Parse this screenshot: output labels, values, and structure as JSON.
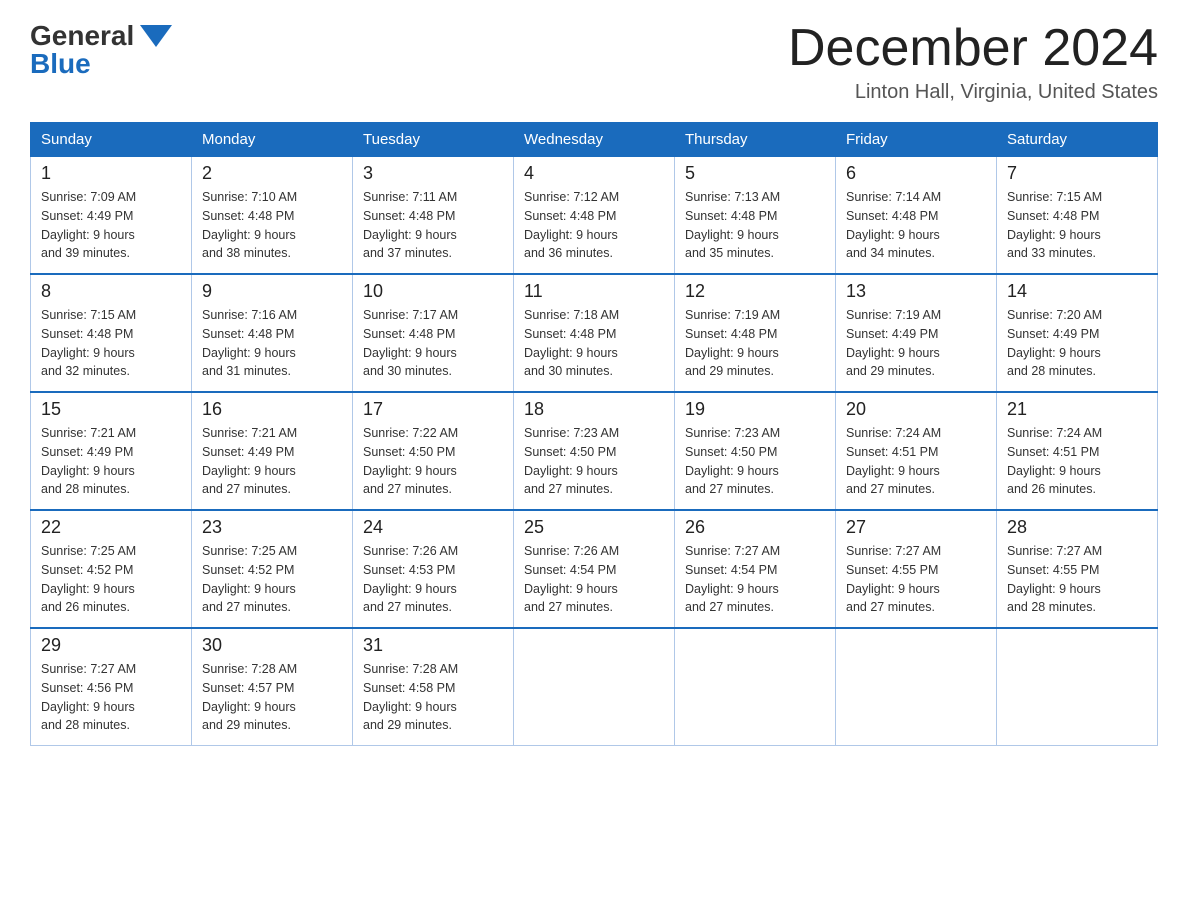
{
  "logo": {
    "general": "General",
    "blue": "Blue"
  },
  "title": "December 2024",
  "location": "Linton Hall, Virginia, United States",
  "weekdays": [
    "Sunday",
    "Monday",
    "Tuesday",
    "Wednesday",
    "Thursday",
    "Friday",
    "Saturday"
  ],
  "weeks": [
    [
      {
        "day": "1",
        "sunrise": "7:09 AM",
        "sunset": "4:49 PM",
        "daylight": "9 hours and 39 minutes."
      },
      {
        "day": "2",
        "sunrise": "7:10 AM",
        "sunset": "4:48 PM",
        "daylight": "9 hours and 38 minutes."
      },
      {
        "day": "3",
        "sunrise": "7:11 AM",
        "sunset": "4:48 PM",
        "daylight": "9 hours and 37 minutes."
      },
      {
        "day": "4",
        "sunrise": "7:12 AM",
        "sunset": "4:48 PM",
        "daylight": "9 hours and 36 minutes."
      },
      {
        "day": "5",
        "sunrise": "7:13 AM",
        "sunset": "4:48 PM",
        "daylight": "9 hours and 35 minutes."
      },
      {
        "day": "6",
        "sunrise": "7:14 AM",
        "sunset": "4:48 PM",
        "daylight": "9 hours and 34 minutes."
      },
      {
        "day": "7",
        "sunrise": "7:15 AM",
        "sunset": "4:48 PM",
        "daylight": "9 hours and 33 minutes."
      }
    ],
    [
      {
        "day": "8",
        "sunrise": "7:15 AM",
        "sunset": "4:48 PM",
        "daylight": "9 hours and 32 minutes."
      },
      {
        "day": "9",
        "sunrise": "7:16 AM",
        "sunset": "4:48 PM",
        "daylight": "9 hours and 31 minutes."
      },
      {
        "day": "10",
        "sunrise": "7:17 AM",
        "sunset": "4:48 PM",
        "daylight": "9 hours and 30 minutes."
      },
      {
        "day": "11",
        "sunrise": "7:18 AM",
        "sunset": "4:48 PM",
        "daylight": "9 hours and 30 minutes."
      },
      {
        "day": "12",
        "sunrise": "7:19 AM",
        "sunset": "4:48 PM",
        "daylight": "9 hours and 29 minutes."
      },
      {
        "day": "13",
        "sunrise": "7:19 AM",
        "sunset": "4:49 PM",
        "daylight": "9 hours and 29 minutes."
      },
      {
        "day": "14",
        "sunrise": "7:20 AM",
        "sunset": "4:49 PM",
        "daylight": "9 hours and 28 minutes."
      }
    ],
    [
      {
        "day": "15",
        "sunrise": "7:21 AM",
        "sunset": "4:49 PM",
        "daylight": "9 hours and 28 minutes."
      },
      {
        "day": "16",
        "sunrise": "7:21 AM",
        "sunset": "4:49 PM",
        "daylight": "9 hours and 27 minutes."
      },
      {
        "day": "17",
        "sunrise": "7:22 AM",
        "sunset": "4:50 PM",
        "daylight": "9 hours and 27 minutes."
      },
      {
        "day": "18",
        "sunrise": "7:23 AM",
        "sunset": "4:50 PM",
        "daylight": "9 hours and 27 minutes."
      },
      {
        "day": "19",
        "sunrise": "7:23 AM",
        "sunset": "4:50 PM",
        "daylight": "9 hours and 27 minutes."
      },
      {
        "day": "20",
        "sunrise": "7:24 AM",
        "sunset": "4:51 PM",
        "daylight": "9 hours and 27 minutes."
      },
      {
        "day": "21",
        "sunrise": "7:24 AM",
        "sunset": "4:51 PM",
        "daylight": "9 hours and 26 minutes."
      }
    ],
    [
      {
        "day": "22",
        "sunrise": "7:25 AM",
        "sunset": "4:52 PM",
        "daylight": "9 hours and 26 minutes."
      },
      {
        "day": "23",
        "sunrise": "7:25 AM",
        "sunset": "4:52 PM",
        "daylight": "9 hours and 27 minutes."
      },
      {
        "day": "24",
        "sunrise": "7:26 AM",
        "sunset": "4:53 PM",
        "daylight": "9 hours and 27 minutes."
      },
      {
        "day": "25",
        "sunrise": "7:26 AM",
        "sunset": "4:54 PM",
        "daylight": "9 hours and 27 minutes."
      },
      {
        "day": "26",
        "sunrise": "7:27 AM",
        "sunset": "4:54 PM",
        "daylight": "9 hours and 27 minutes."
      },
      {
        "day": "27",
        "sunrise": "7:27 AM",
        "sunset": "4:55 PM",
        "daylight": "9 hours and 27 minutes."
      },
      {
        "day": "28",
        "sunrise": "7:27 AM",
        "sunset": "4:55 PM",
        "daylight": "9 hours and 28 minutes."
      }
    ],
    [
      {
        "day": "29",
        "sunrise": "7:27 AM",
        "sunset": "4:56 PM",
        "daylight": "9 hours and 28 minutes."
      },
      {
        "day": "30",
        "sunrise": "7:28 AM",
        "sunset": "4:57 PM",
        "daylight": "9 hours and 29 minutes."
      },
      {
        "day": "31",
        "sunrise": "7:28 AM",
        "sunset": "4:58 PM",
        "daylight": "9 hours and 29 minutes."
      },
      null,
      null,
      null,
      null
    ]
  ],
  "labels": {
    "sunrise": "Sunrise: ",
    "sunset": "Sunset: ",
    "daylight": "Daylight: "
  }
}
